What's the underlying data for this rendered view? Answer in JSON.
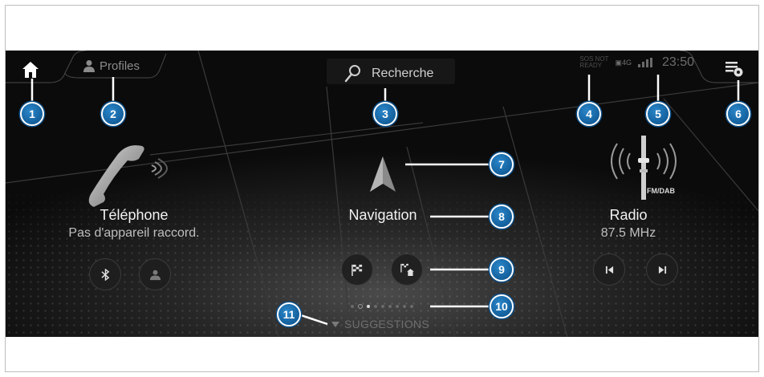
{
  "topbar": {
    "profiles_label": "Profiles",
    "search_label": "Recherche",
    "sos_line1": "SOS NOT",
    "sos_line2": "READY",
    "sim_label": "4G",
    "clock": "23:50"
  },
  "widgets": {
    "phone": {
      "title": "Téléphone",
      "subtitle": "Pas d'appareil raccord."
    },
    "navigation": {
      "title": "Navigation"
    },
    "radio": {
      "title": "Radio",
      "frequency": "87.5 MHz",
      "band": "FM/DAB"
    }
  },
  "pager": {
    "count": 9,
    "active_index": 2
  },
  "suggestions_label": "SUGGESTIONS",
  "callouts": [
    "1",
    "2",
    "3",
    "4",
    "5",
    "6",
    "7",
    "8",
    "9",
    "10",
    "11"
  ],
  "icons": {
    "home": "home-icon",
    "profile": "person-icon",
    "search": "search-icon",
    "notifications": "notification-settings-icon",
    "bluetooth": "bluetooth-icon",
    "contacts": "contact-icon",
    "destination": "checkered-flag-icon",
    "home_destination": "flag-home-icon",
    "prev": "previous-station-icon",
    "next": "next-station-icon"
  },
  "colors": {
    "callout_fill": "#1565a8",
    "screen_bg": "#111111",
    "text_primary": "#f2f2f2"
  }
}
